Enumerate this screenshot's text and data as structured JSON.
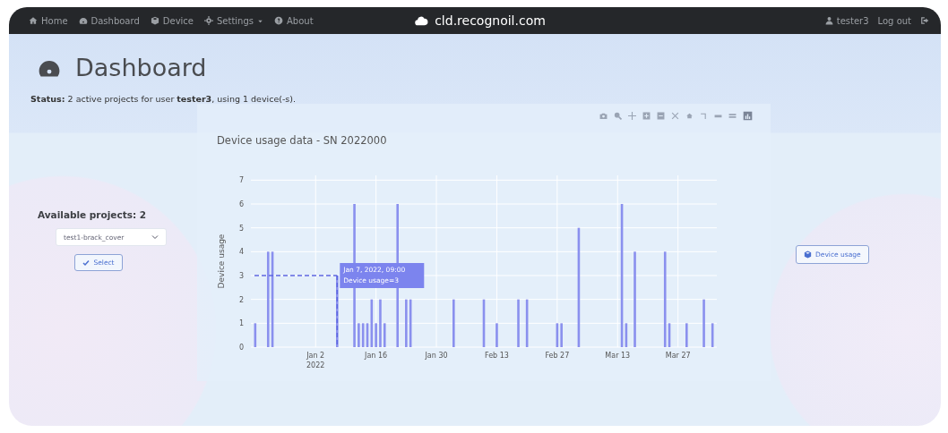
{
  "navbar": {
    "items": [
      {
        "label": "Home",
        "kind": "link"
      },
      {
        "label": "Dashboard",
        "kind": "link"
      },
      {
        "label": "Device",
        "kind": "link"
      },
      {
        "label": "Settings",
        "kind": "dropdown"
      },
      {
        "label": "About",
        "kind": "link"
      }
    ],
    "site": "cld.recognoil.com",
    "user": "tester3",
    "logout": "Log out"
  },
  "page": {
    "title": "Dashboard",
    "status": "**Status:** 2 active projects for user **tester3**, using 1 device(-s)."
  },
  "projects": {
    "heading": "Available projects: 2",
    "selected_project": "test1-brack_cover",
    "select_button": "Select"
  },
  "device_button": "Device usage",
  "chart": {
    "chart_data": {
      "type": "bar",
      "title": "Device usage data - SN 2022000",
      "ylabel": "Device usage",
      "x": [
        "2021-12-19",
        "2021-12-22",
        "2021-12-23",
        "2022-01-07",
        "2022-01-11",
        "2022-01-12",
        "2022-01-13",
        "2022-01-14",
        "2022-01-15",
        "2022-01-16",
        "2022-01-17",
        "2022-01-18",
        "2022-01-21",
        "2022-01-23",
        "2022-01-24",
        "2022-02-03",
        "2022-02-10",
        "2022-02-13",
        "2022-02-18",
        "2022-02-20",
        "2022-02-27",
        "2022-02-28",
        "2022-03-04",
        "2022-03-14",
        "2022-03-15",
        "2022-03-17",
        "2022-03-24",
        "2022-03-25",
        "2022-03-29",
        "2022-04-02",
        "2022-04-04"
      ],
      "grid": true,
      "series": [
        {
          "color": "#8a90ee",
          "values": [
            1,
            4,
            4,
            3,
            6,
            1,
            1,
            1,
            2,
            1,
            2,
            1,
            6,
            2,
            2,
            2,
            2,
            1,
            2,
            2,
            1,
            1,
            5,
            6,
            1,
            4,
            4,
            1,
            1,
            2,
            1
          ]
        }
      ],
      "xlim": [
        "2021-12-18",
        "2022-04-05"
      ],
      "ylim": [
        0,
        7.2
      ],
      "xticks": [
        {
          "value": "2022-01-02",
          "label": "Jan 2\n2022"
        },
        {
          "value": "2022-01-16",
          "label": "Jan 16"
        },
        {
          "value": "2022-01-30",
          "label": "Jan 30"
        },
        {
          "value": "2022-02-13",
          "label": "Feb 13"
        },
        {
          "value": "2022-02-27",
          "label": "Feb 27"
        },
        {
          "value": "2022-03-13",
          "label": "Mar 13"
        },
        {
          "value": "2022-03-27",
          "label": "Mar 27"
        }
      ],
      "yticks": [
        0,
        1,
        2,
        3,
        4,
        5,
        6,
        7
      ],
      "annotations": [
        {
          "x": "2022-01-07",
          "y": 3,
          "text": "Jan 7, 2022, 09:00\nDevice usage=3"
        }
      ]
    }
  }
}
